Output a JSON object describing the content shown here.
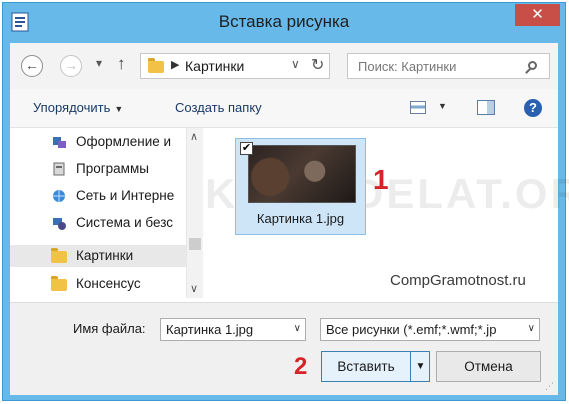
{
  "window": {
    "title": "Вставка рисунка",
    "close_label": "✕"
  },
  "nav": {
    "back_icon": "back-arrow-icon",
    "forward_icon": "forward-arrow-icon",
    "address_folder": "Картинки",
    "search_placeholder": "Поиск: Картинки"
  },
  "toolbar": {
    "organize_label": "Упорядочить",
    "new_folder_label": "Создать папку"
  },
  "sidebar": {
    "items": [
      {
        "label": "Оформление и",
        "icon": "appearance-icon"
      },
      {
        "label": "Программы",
        "icon": "programs-icon"
      },
      {
        "label": "Сеть и Интерне",
        "icon": "network-icon"
      },
      {
        "label": "Система и безс",
        "icon": "system-icon"
      },
      {
        "label": "Картинки",
        "icon": "folder-icon",
        "selected": true
      },
      {
        "label": "Консенсус",
        "icon": "folder-icon"
      }
    ]
  },
  "content": {
    "files": [
      {
        "name": "Картинка 1.jpg",
        "checked": true
      }
    ],
    "annotation_1": "1",
    "watermark": "KAK-SDELAT.ORG",
    "credit": "CompGramotnost.ru"
  },
  "bottom": {
    "file_name_label": "Имя файла:",
    "file_name_value": "Картинка 1.jpg",
    "file_type_value": "Все рисунки (*.emf;*.wmf;*.jp",
    "insert_label": "Вставить",
    "cancel_label": "Отмена",
    "annotation_2": "2"
  }
}
